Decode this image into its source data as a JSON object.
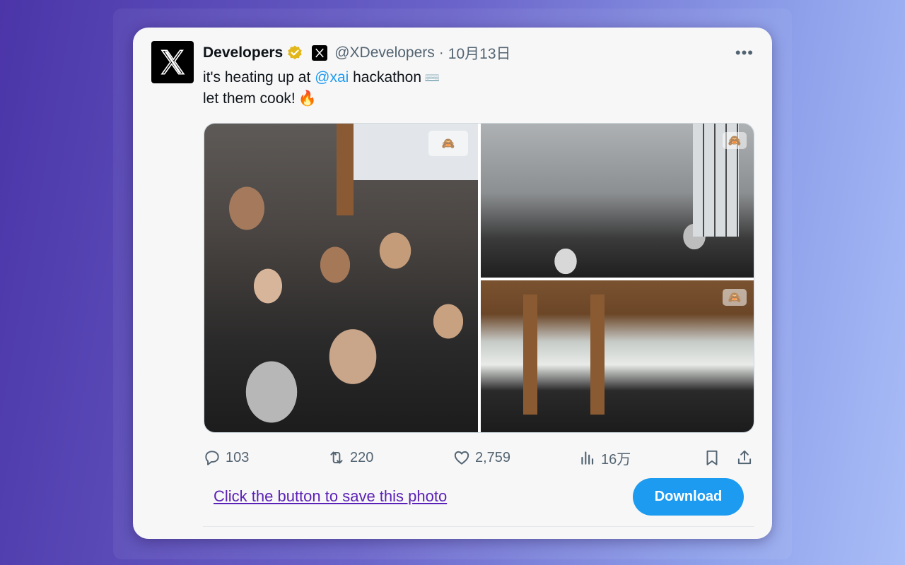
{
  "tweet": {
    "author_name": "Developers",
    "handle": "@XDevelopers",
    "separator": "·",
    "date": "10月13日",
    "more_label": "•••",
    "text_line1_prefix": "it's heating up at ",
    "mention": "@xai",
    "text_line1_suffix": " hackathon",
    "keyboard_emoji": "⌨️",
    "text_line2": "let them cook!",
    "fire_emoji": "🔥",
    "alt_badge_emoji": "🙈",
    "avatar_logo": "𝕏"
  },
  "metrics": {
    "replies": "103",
    "retweets": "220",
    "likes": "2,759",
    "views": "16万"
  },
  "page": {
    "save_prompt": "Click the button to save this photo",
    "download_label": "Download"
  },
  "colors": {
    "accent": "#1d9bf0",
    "link": "#5b21b6",
    "verified": "#e2b719"
  },
  "icons": [
    "reply-icon",
    "retweet-icon",
    "like-icon",
    "views-icon",
    "bookmark-icon",
    "share-icon",
    "verified-badge-icon",
    "x-logo-icon",
    "more-icon"
  ]
}
